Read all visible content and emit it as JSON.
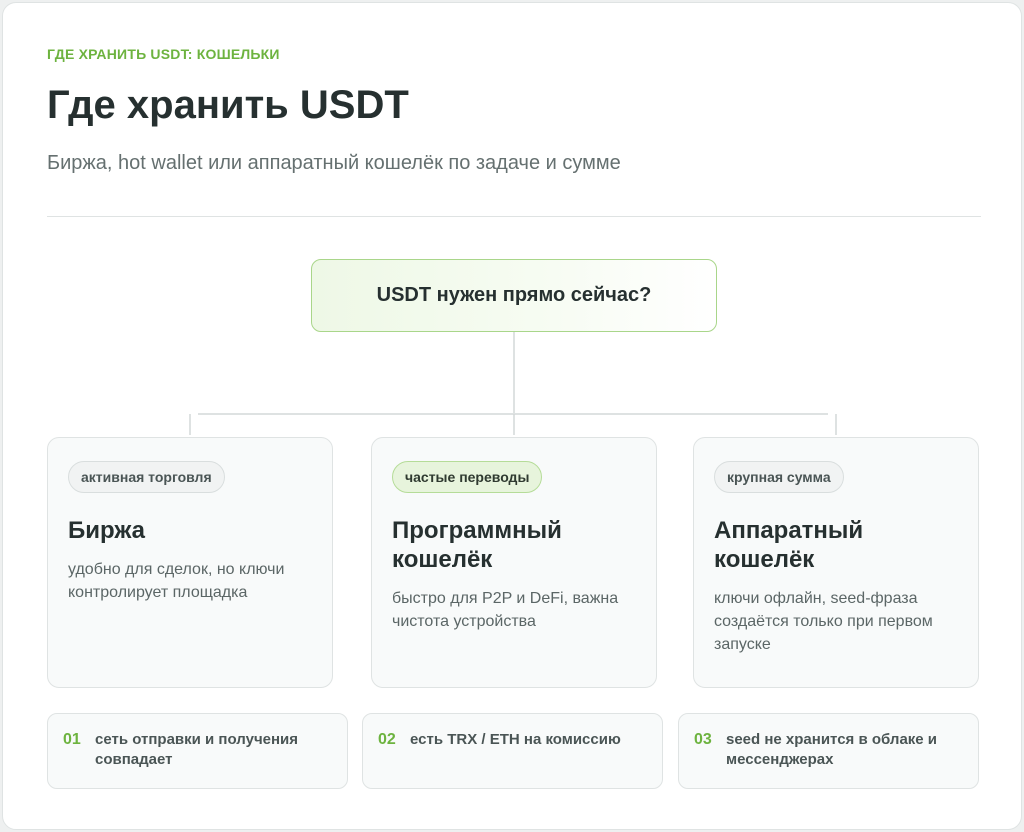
{
  "header": {
    "eyebrow": "ГДЕ ХРАНИТЬ USDT: КОШЕЛЬКИ",
    "title": "Где хранить USDT",
    "subtitle": "Биржа, hot wallet или аппаратный кошелёк по задаче и сумме"
  },
  "question": {
    "label": "USDT нужен прямо сейчас?"
  },
  "options": [
    {
      "tag": "активная торговля",
      "title": "Биржа",
      "description": "удобно для сделок, но ключи контролирует площадка"
    },
    {
      "tag": "частые переводы",
      "title": "Программный кошелёк",
      "description": "быстро для P2P и DeFi, важна чистота устройства"
    },
    {
      "tag": "крупная сумма",
      "title": "Аппаратный кошелёк",
      "description": "ключи офлайн, seed-фраза создаётся только при первом запуске"
    }
  ],
  "checklist": [
    {
      "num": "01",
      "text": "сеть отправки и получения совпадает"
    },
    {
      "num": "02",
      "text": "есть TRX / ETH на комиссию"
    },
    {
      "num": "03",
      "text": "seed не хранится в облаке и мессенджерах"
    }
  ],
  "colors": {
    "accent": "#6db33f",
    "accent_light": "#e7f4dc",
    "text": "#263030",
    "muted": "#657070",
    "border": "#dfe3e3"
  }
}
